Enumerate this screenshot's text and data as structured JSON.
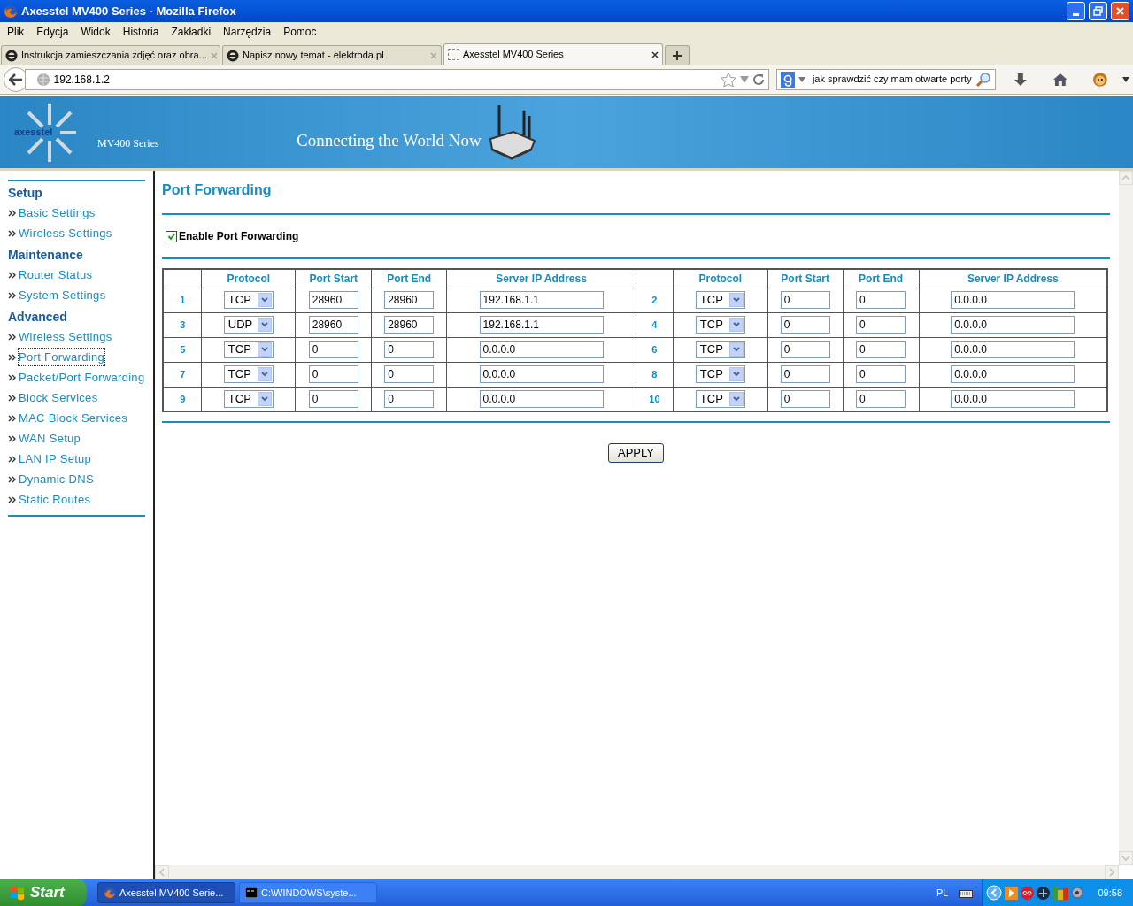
{
  "window": {
    "title": "Axesstel MV400 Series - Mozilla Firefox"
  },
  "menu": [
    "Plik",
    "Edycja",
    "Widok",
    "Historia",
    "Zakładki",
    "Narzędzia",
    "Pomoc"
  ],
  "tabs": [
    {
      "label": "Instrukcja zamieszczania zdjęć oraz obra...",
      "selected": false,
      "kind": "ie"
    },
    {
      "label": "Napisz nowy temat - elektroda.pl",
      "selected": false,
      "kind": "ie"
    },
    {
      "label": "Axesstel MV400 Series",
      "selected": true,
      "kind": "blank"
    }
  ],
  "address": {
    "url": "192.168.1.2"
  },
  "search": {
    "value": "jak sprawdzić czy mam otwarte porty"
  },
  "banner": {
    "logo": "axesstel",
    "series": "MV400 Series",
    "slogan": "Connecting the World Now"
  },
  "sidebar": [
    {
      "heading": "Setup",
      "items": [
        {
          "label": "Basic Settings",
          "selected": false
        },
        {
          "label": "Wireless Settings",
          "selected": false
        }
      ]
    },
    {
      "heading": "Maintenance",
      "items": [
        {
          "label": "Router Status",
          "selected": false
        },
        {
          "label": "System Settings",
          "selected": false
        }
      ]
    },
    {
      "heading": "Advanced",
      "items": [
        {
          "label": "Wireless Settings",
          "selected": false
        },
        {
          "label": "Port Forwarding",
          "selected": true
        },
        {
          "label": "Packet/Port Forwarding",
          "selected": false
        },
        {
          "label": "Block Services",
          "selected": false
        },
        {
          "label": "MAC Block Services",
          "selected": false
        },
        {
          "label": "WAN Setup",
          "selected": false
        },
        {
          "label": "LAN IP Setup",
          "selected": false
        },
        {
          "label": "Dynamic DNS",
          "selected": false
        },
        {
          "label": "Static Routes",
          "selected": false
        }
      ]
    }
  ],
  "page_title": "Port Forwarding",
  "enable": {
    "label": "Enable Port Forwarding",
    "checked": true
  },
  "table": {
    "columns": [
      "Protocol",
      "Port Start",
      "Port End",
      "Server IP Address",
      "Protocol",
      "Port Start",
      "Port End",
      "Server IP Address"
    ],
    "rows": [
      [
        {
          "number": "1",
          "protocol": "TCP",
          "port_start": "28960",
          "port_end": "28960",
          "server_ip": "192.168.1.1"
        },
        {
          "number": "2",
          "protocol": "TCP",
          "port_start": "0",
          "port_end": "0",
          "server_ip": "0.0.0.0"
        }
      ],
      [
        {
          "number": "3",
          "protocol": "UDP",
          "port_start": "28960",
          "port_end": "28960",
          "server_ip": "192.168.1.1"
        },
        {
          "number": "4",
          "protocol": "TCP",
          "port_start": "0",
          "port_end": "0",
          "server_ip": "0.0.0.0"
        }
      ],
      [
        {
          "number": "5",
          "protocol": "TCP",
          "port_start": "0",
          "port_end": "0",
          "server_ip": "0.0.0.0"
        },
        {
          "number": "6",
          "protocol": "TCP",
          "port_start": "0",
          "port_end": "0",
          "server_ip": "0.0.0.0"
        }
      ],
      [
        {
          "number": "7",
          "protocol": "TCP",
          "port_start": "0",
          "port_end": "0",
          "server_ip": "0.0.0.0"
        },
        {
          "number": "8",
          "protocol": "TCP",
          "port_start": "0",
          "port_end": "0",
          "server_ip": "0.0.0.0"
        }
      ],
      [
        {
          "number": "9",
          "protocol": "TCP",
          "port_start": "0",
          "port_end": "0",
          "server_ip": "0.0.0.0"
        },
        {
          "number": "10",
          "protocol": "TCP",
          "port_start": "0",
          "port_end": "0",
          "server_ip": "0.0.0.0"
        }
      ]
    ]
  },
  "apply_button": "APPLY",
  "taskbar": {
    "start": "Start",
    "tasks": [
      {
        "label": "Axesstel MV400 Serie...",
        "selected": true,
        "kind": "firefox"
      },
      {
        "label": "C:\\WINDOWS\\syste...",
        "selected": false,
        "kind": "console"
      }
    ],
    "language": "PL",
    "time": "09:58"
  }
}
